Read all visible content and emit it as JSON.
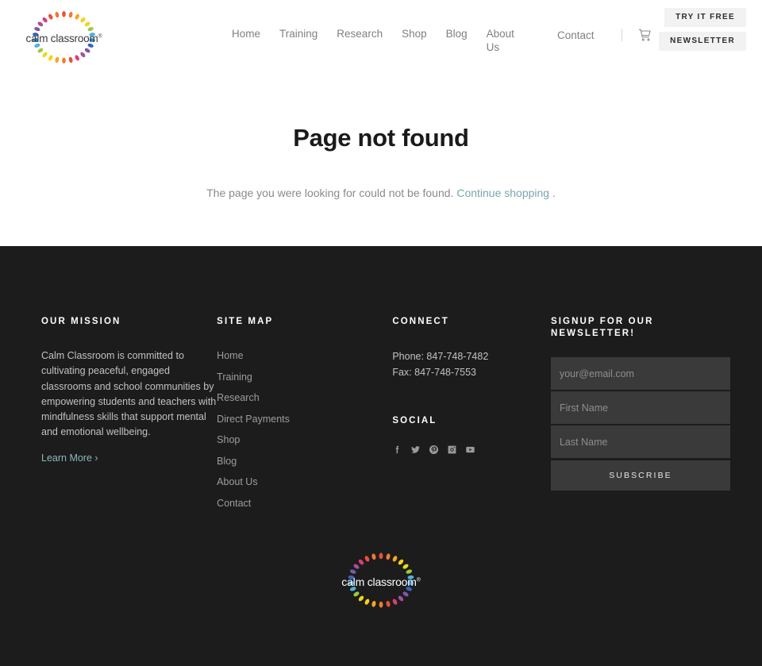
{
  "header": {
    "logo": {
      "wordmark": "calm classroom",
      "registered": "®",
      "icon_name": "calm-classroom-petal-ring-logo"
    },
    "nav": [
      {
        "label": "Home"
      },
      {
        "label": "Training"
      },
      {
        "label": "Research"
      },
      {
        "label": "Shop"
      },
      {
        "label": "Blog"
      },
      {
        "label": "About Us"
      }
    ],
    "contact_label": "Contact",
    "cart_icon": "shopping-cart-icon",
    "buttons": [
      {
        "label": "TRY IT FREE"
      },
      {
        "label": "NEWSLETTER"
      }
    ]
  },
  "main": {
    "title": "Page not found",
    "body_before": "The page you were looking for could not be found.",
    "link_text": "Continue shopping",
    "body_after": "."
  },
  "footer": {
    "mission": {
      "heading": "OUR MISSION",
      "text": "Calm Classroom is committed to cultivating peaceful, engaged classrooms and school communities by empowering students and teachers with mindfulness skills that support mental and emotional wellbeing.",
      "link_label": "Learn More ›"
    },
    "sitemap": {
      "heading": "SITE MAP",
      "links": [
        {
          "label": "Home"
        },
        {
          "label": "Training"
        },
        {
          "label": "Research"
        },
        {
          "label": "Direct Payments"
        },
        {
          "label": "Shop"
        },
        {
          "label": "Blog"
        },
        {
          "label": "About Us"
        },
        {
          "label": "Contact"
        }
      ]
    },
    "connect": {
      "heading": "CONNECT",
      "phone": "Phone: 847-748-7482",
      "fax": "Fax: 847-748-7553",
      "social_heading": "SOCIAL",
      "social": [
        {
          "name": "facebook-icon"
        },
        {
          "name": "twitter-icon"
        },
        {
          "name": "pinterest-icon"
        },
        {
          "name": "instagram-icon"
        },
        {
          "name": "youtube-icon"
        }
      ]
    },
    "signup": {
      "heading": "SIGNUP FOR OUR NEWSLETTER!",
      "email_placeholder": "your@email.com",
      "email_value": "",
      "first_name_placeholder": "First Name",
      "first_name_value": "",
      "last_name_placeholder": "Last Name",
      "last_name_value": "",
      "submit_label": "SUBSCRIBE"
    },
    "logo": {
      "wordmark": "calm classroom",
      "registered": "®",
      "icon_name": "calm-classroom-petal-ring-logo"
    }
  },
  "colors": {
    "footer_bg": "#1c1c1c",
    "link_teal": "#77a7ad",
    "input_bg": "#3a3a3a",
    "button_bg": "#f2f2f2",
    "petals": [
      "#e8503a",
      "#ef7b33",
      "#f5a623",
      "#f7d117",
      "#e8d820",
      "#9fc93c",
      "#4fb1e0",
      "#2f8fd4",
      "#3a63b5",
      "#7e57a8",
      "#a3519b",
      "#d6407a"
    ]
  }
}
